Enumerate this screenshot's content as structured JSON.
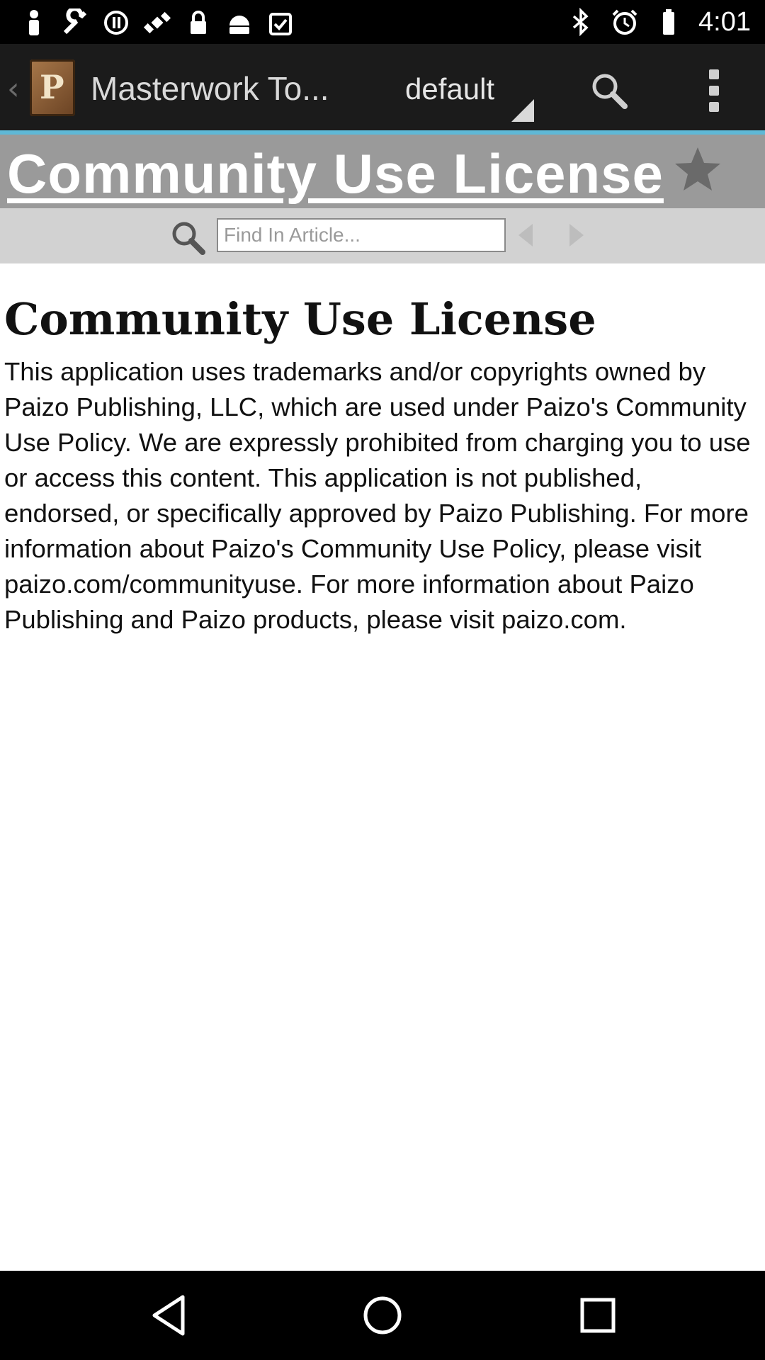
{
  "status_bar": {
    "time": "4:01",
    "left_icons": [
      "person-icon",
      "wrench-icon",
      "sync-icon",
      "satellite-icon",
      "lock-icon",
      "android-icon",
      "clipboard-check-icon"
    ],
    "right_icons": [
      "bluetooth-icon",
      "alarm-icon",
      "battery-icon"
    ]
  },
  "action_bar": {
    "title": "Masterwork To...",
    "dropdown_value": "default"
  },
  "article_header": {
    "title": "Community Use License"
  },
  "find_bar": {
    "placeholder": "Find In Article..."
  },
  "article": {
    "heading": "Community Use License",
    "body": "This application uses trademarks and/or copyrights owned by Paizo Publishing, LLC, which are used under Paizo's Community Use Policy. We are expressly prohibited from charging you to use or access this content. This application is not published, endorsed, or specifically approved by Paizo Publishing. For more information about Paizo's Community Use Policy, please visit paizo.com/communityuse. For more information about Paizo Publishing and Paizo products, please visit paizo.com."
  },
  "colors": {
    "accent": "#5fb8d6",
    "header_gray": "#9a9a9a",
    "findbar_gray": "#d2d2d2"
  }
}
